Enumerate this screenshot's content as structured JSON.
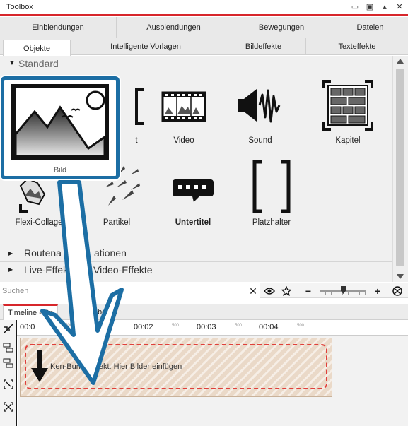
{
  "window": {
    "title": "Toolbox",
    "controls": [
      "▭",
      "▣",
      "▴",
      "✕"
    ]
  },
  "tabs": {
    "row1": [
      "Einblendungen",
      "Ausblendungen",
      "Bewegungen",
      "Dateien"
    ],
    "row2": [
      "Objekte",
      "Intelligente Vorlagen",
      "Bildeffekte",
      "Texteffekte"
    ],
    "active": "Objekte"
  },
  "objects": {
    "section_standard": "Standard",
    "items": [
      {
        "label": "Bild",
        "icon": "image-icon"
      },
      {
        "label": "Text",
        "icon": "text-icon"
      },
      {
        "label": "Video",
        "icon": "video-icon"
      },
      {
        "label": "Sound",
        "icon": "sound-icon"
      },
      {
        "label": "Kapitel",
        "icon": "chapter-icon"
      },
      {
        "label": "Flexi-Collage",
        "icon": "collage-icon"
      },
      {
        "label": "Partikel",
        "icon": "particle-icon"
      },
      {
        "label": "Untertitel",
        "icon": "subtitle-icon"
      },
      {
        "label": "Platzhalter",
        "icon": "placeholder-icon"
      }
    ],
    "partial_text_label": "t",
    "section_route": "Routenanimationen",
    "section_live_left": "Live-Effek",
    "section_live_right": "Video-Effekte",
    "section_route_visible": "Routena",
    "section_route_visible2": "ationen"
  },
  "search": {
    "placeholder": "Suchen",
    "clear_icon": "close-icon",
    "eye_icon": "eye-icon",
    "favorite_icon": "star-icon",
    "zoom_out": "−",
    "zoom_in": "+",
    "zoom_level": 0.45,
    "fit_icon": "zoom-fit-icon"
  },
  "timeline": {
    "tab_active": "Timeline - Sp",
    "tab_other": "board",
    "ruler_major": [
      "00:0",
      "00:02",
      "00:03",
      "00:04"
    ],
    "ruler_minor": [
      "500",
      "500",
      "500",
      "500"
    ],
    "clip_text": "Ken-Burns-Effekt: Hier Bilder einfügen"
  },
  "colors": {
    "accent_red": "#d7262b",
    "highlight_blue": "#1c6ea4",
    "dash_red": "#e0403b",
    "clip_fill": "#ead9c8"
  }
}
